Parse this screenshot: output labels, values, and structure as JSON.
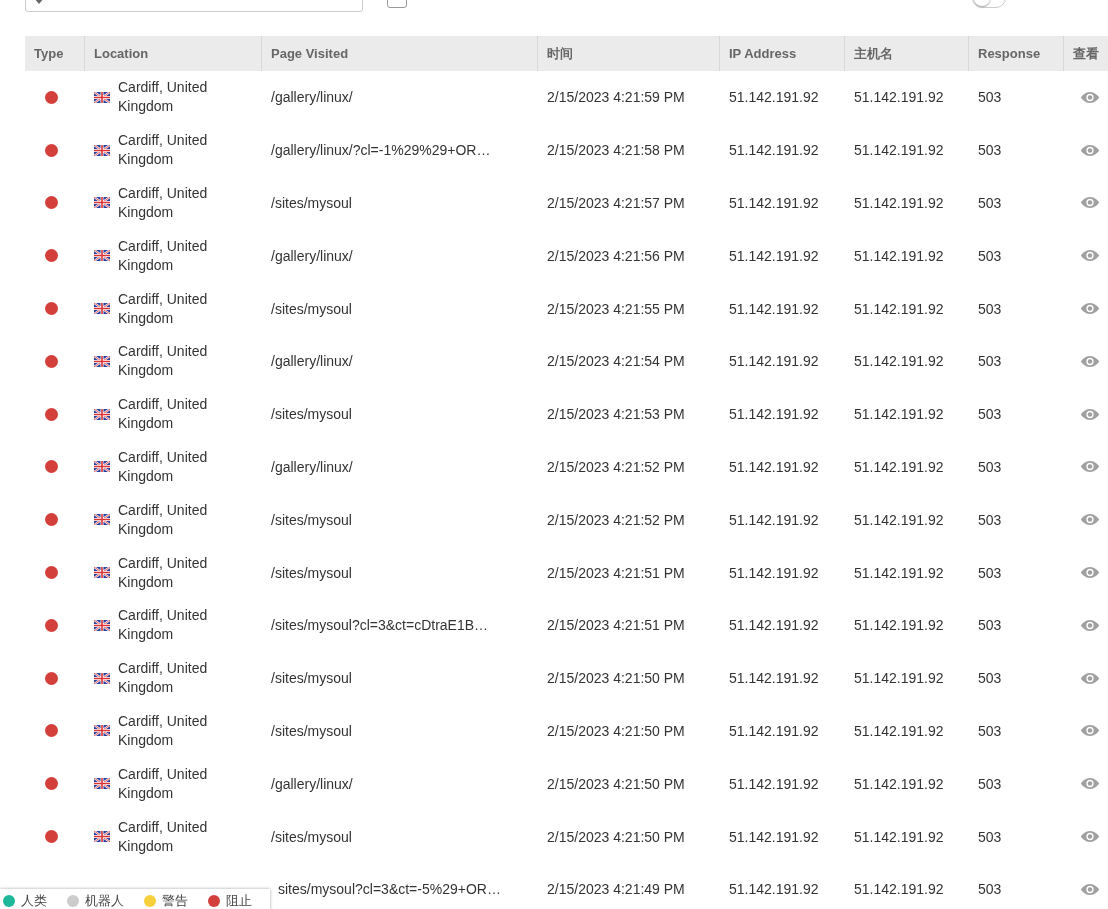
{
  "filters": {
    "advanced_filter": {
      "checked": false
    },
    "expand_all": {
      "on": false
    }
  },
  "table": {
    "columns": [
      "Type",
      "Location",
      "Page Visited",
      "时间",
      "IP Address",
      "主机名",
      "Response",
      "查看"
    ],
    "rows": [
      {
        "color": "#d33f3a",
        "location": "Cardiff, United Kingdom",
        "page": "/gallery/linux/",
        "time": "2/15/2023 4:21:59 PM",
        "ip": "51.142.191.92",
        "host": "51.142.191.92",
        "response": "503"
      },
      {
        "color": "#d33f3a",
        "location": "Cardiff, United Kingdom",
        "page": "/gallery/linux/?cl=-1%29%29+OR…",
        "time": "2/15/2023 4:21:58 PM",
        "ip": "51.142.191.92",
        "host": "51.142.191.92",
        "response": "503"
      },
      {
        "color": "#d33f3a",
        "location": "Cardiff, United Kingdom",
        "page": "/sites/mysoul",
        "time": "2/15/2023 4:21:57 PM",
        "ip": "51.142.191.92",
        "host": "51.142.191.92",
        "response": "503"
      },
      {
        "color": "#d33f3a",
        "location": "Cardiff, United Kingdom",
        "page": "/gallery/linux/",
        "time": "2/15/2023 4:21:56 PM",
        "ip": "51.142.191.92",
        "host": "51.142.191.92",
        "response": "503"
      },
      {
        "color": "#d33f3a",
        "location": "Cardiff, United Kingdom",
        "page": "/sites/mysoul",
        "time": "2/15/2023 4:21:55 PM",
        "ip": "51.142.191.92",
        "host": "51.142.191.92",
        "response": "503"
      },
      {
        "color": "#d33f3a",
        "location": "Cardiff, United Kingdom",
        "page": "/gallery/linux/",
        "time": "2/15/2023 4:21:54 PM",
        "ip": "51.142.191.92",
        "host": "51.142.191.92",
        "response": "503"
      },
      {
        "color": "#d33f3a",
        "location": "Cardiff, United Kingdom",
        "page": "/sites/mysoul",
        "time": "2/15/2023 4:21:53 PM",
        "ip": "51.142.191.92",
        "host": "51.142.191.92",
        "response": "503"
      },
      {
        "color": "#d33f3a",
        "location": "Cardiff, United Kingdom",
        "page": "/gallery/linux/",
        "time": "2/15/2023 4:21:52 PM",
        "ip": "51.142.191.92",
        "host": "51.142.191.92",
        "response": "503"
      },
      {
        "color": "#d33f3a",
        "location": "Cardiff, United Kingdom",
        "page": "/sites/mysoul",
        "time": "2/15/2023 4:21:52 PM",
        "ip": "51.142.191.92",
        "host": "51.142.191.92",
        "response": "503"
      },
      {
        "color": "#d33f3a",
        "location": "Cardiff, United Kingdom",
        "page": "/sites/mysoul",
        "time": "2/15/2023 4:21:51 PM",
        "ip": "51.142.191.92",
        "host": "51.142.191.92",
        "response": "503"
      },
      {
        "color": "#d33f3a",
        "location": "Cardiff, United Kingdom",
        "page": "/sites/mysoul?cl=3&ct=cDtraE1B…",
        "time": "2/15/2023 4:21:51 PM",
        "ip": "51.142.191.92",
        "host": "51.142.191.92",
        "response": "503"
      },
      {
        "color": "#d33f3a",
        "location": "Cardiff, United Kingdom",
        "page": "/sites/mysoul",
        "time": "2/15/2023 4:21:50 PM",
        "ip": "51.142.191.92",
        "host": "51.142.191.92",
        "response": "503"
      },
      {
        "color": "#d33f3a",
        "location": "Cardiff, United Kingdom",
        "page": "/sites/mysoul",
        "time": "2/15/2023 4:21:50 PM",
        "ip": "51.142.191.92",
        "host": "51.142.191.92",
        "response": "503"
      },
      {
        "color": "#d33f3a",
        "location": "Cardiff, United Kingdom",
        "page": "/gallery/linux/",
        "time": "2/15/2023 4:21:50 PM",
        "ip": "51.142.191.92",
        "host": "51.142.191.92",
        "response": "503"
      },
      {
        "color": "#d33f3a",
        "location": "Cardiff, United Kingdom",
        "page": "/sites/mysoul",
        "time": "2/15/2023 4:21:50 PM",
        "ip": "51.142.191.92",
        "host": "51.142.191.92",
        "response": "503"
      },
      {
        "page": "sites/mysoul?cl=3&ct=-5%29+OR…",
        "time": "2/15/2023 4:21:49 PM",
        "ip": "51.142.191.92",
        "host": "51.142.191.92",
        "response": "503"
      }
    ]
  },
  "legend": [
    {
      "label": "人类",
      "color": "#1fb79a"
    },
    {
      "label": "机器人",
      "color": "#cccccc"
    },
    {
      "label": "警告",
      "color": "#f6cf3a"
    },
    {
      "label": "阻止",
      "color": "#d33f3a"
    }
  ]
}
